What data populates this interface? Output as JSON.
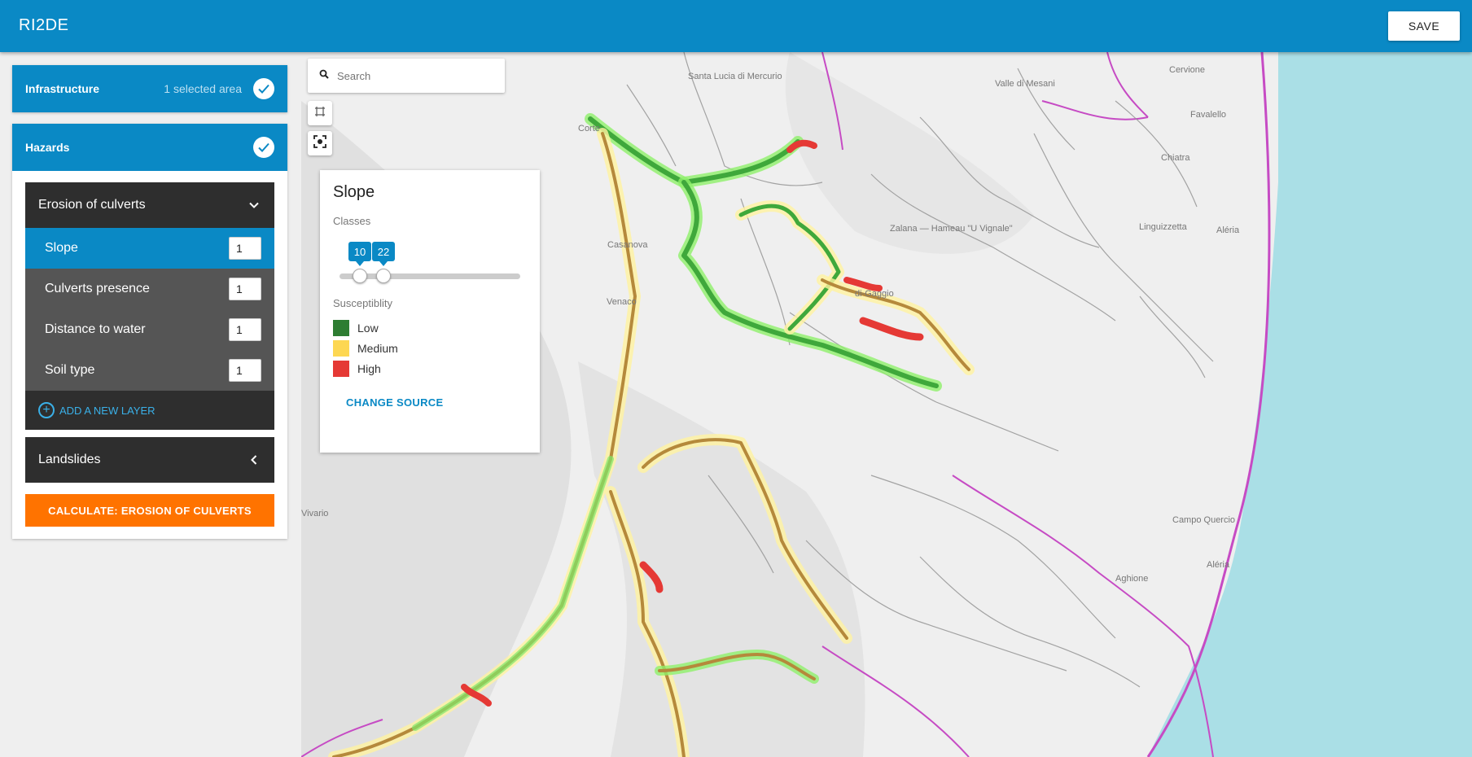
{
  "app": {
    "title": "RI2DE",
    "save_label": "SAVE"
  },
  "infrastructure": {
    "title": "Infrastructure",
    "status": "1 selected area"
  },
  "hazards": {
    "title": "Hazards",
    "erosion": {
      "title": "Erosion of culverts",
      "layers": [
        {
          "label": "Slope",
          "value": "1"
        },
        {
          "label": "Culverts presence",
          "value": "1"
        },
        {
          "label": "Distance to water",
          "value": "1"
        },
        {
          "label": "Soil type",
          "value": "1"
        }
      ],
      "add_label": "ADD A NEW LAYER"
    },
    "landslides": {
      "title": "Landslides"
    },
    "calculate_label": "CALCULATE: EROSION OF CULVERTS"
  },
  "map": {
    "search_placeholder": "Search",
    "place_labels": [
      "Santa Lucia di Mercurio",
      "Valle di Mesani",
      "Cervione",
      "Favalello",
      "Chiatra",
      "Linguizzetta",
      "Zalana — Hameau \"U Vignale\"",
      "Aléria",
      "di-Gaggio",
      "Campo Quercio",
      "Aghione",
      "Casanova",
      "Venaco",
      "Aléria",
      "Vivario",
      "Corte"
    ]
  },
  "legend": {
    "title": "Slope",
    "classes_label": "Classes",
    "slider_low": "10",
    "slider_high": "22",
    "susceptibility_label": "Susceptiblity",
    "items": [
      {
        "label": "Low",
        "color": "#2e7d32"
      },
      {
        "label": "Medium",
        "color": "#fdd752"
      },
      {
        "label": "High",
        "color": "#e53935"
      }
    ],
    "change_source_label": "CHANGE SOURCE"
  }
}
